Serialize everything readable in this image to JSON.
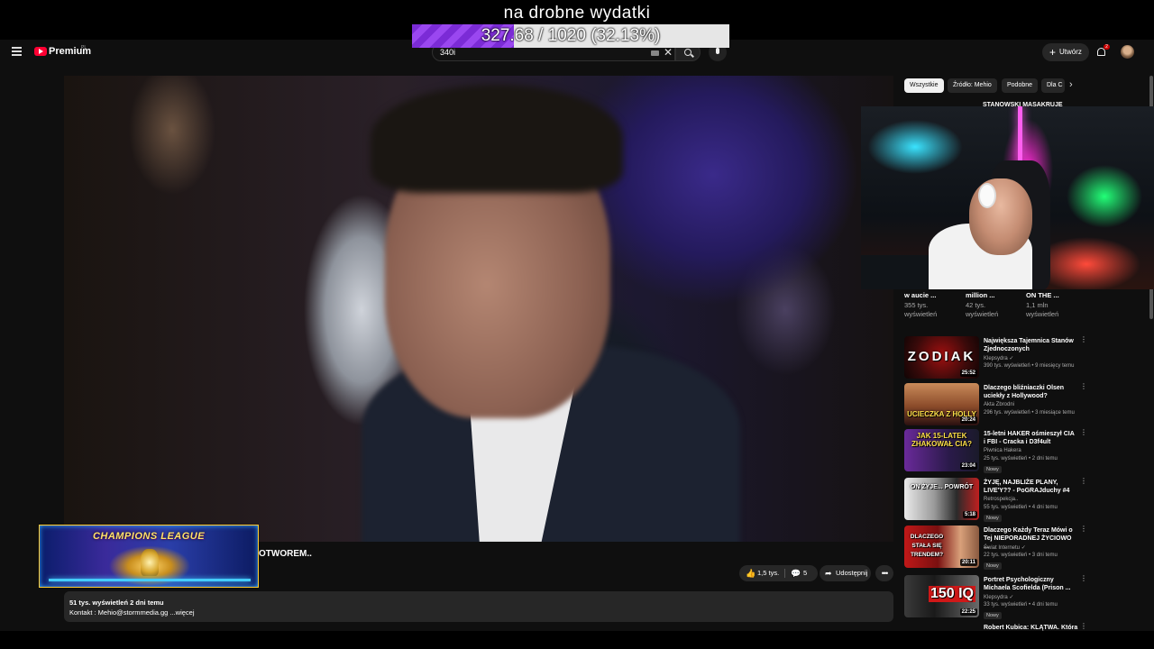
{
  "overlay": {
    "title": "na drobne wydatki",
    "donation_text": "327.68 / 1020 (32.13%)",
    "donation_fraction": 0.3213,
    "fill_color": "#8a3ae6"
  },
  "header": {
    "brand": "Premium",
    "brand_sup": "PL",
    "search_value": "340i",
    "create_label": "Utwórz",
    "notifications_count": "2"
  },
  "video": {
    "title_fragment": "OTWOREM..",
    "likes": "1,5 tys.",
    "comments": "5",
    "share_label": "Udostępnij",
    "more": "•••"
  },
  "description": {
    "line1": "51 tys. wyświetleń  2 dni temu",
    "line2": "Kontakt : Mehio@stormmedia.gg ...więcej"
  },
  "overlay_cl": {
    "title": "CHAMPIONS LEAGUE"
  },
  "chips": [
    {
      "label": "Wszystkie",
      "active": true
    },
    {
      "label": "Źródło: Mehio",
      "active": false
    },
    {
      "label": "Podobne",
      "active": false
    },
    {
      "label": "Dla C",
      "active": false
    }
  ],
  "shorts_peek": {
    "top_title": "STANOWSKI MASAKRUJE",
    "items": [
      {
        "title": "w aucie ...",
        "stat1": "355 tys.",
        "stat2": "wyświetleń"
      },
      {
        "title": "million ...",
        "stat1": "42 tys.",
        "stat2": "wyświetleń"
      },
      {
        "title": "ON THE ...",
        "stat1": "1,1 mln",
        "stat2": "wyświetleń"
      }
    ]
  },
  "recommendations": [
    {
      "title": "Największa Tajemnica Stanów Zjednoczonych",
      "channel": "Klepsydra ✓",
      "views": "390 tys. wyświetleń • 9 miesięcy temu",
      "duration": "25:52",
      "thumb_text": "ZODIAK",
      "new": ""
    },
    {
      "title": "Dlaczego bliźniaczki Olsen uciekły z Hollywood?",
      "channel": "Akta Zbrodni",
      "views": "296 tys. wyświetleń • 3 miesiące temu",
      "duration": "20:24",
      "thumb_text": "UCIECZKA Z HOLLY",
      "new": ""
    },
    {
      "title": "15-letni HAKER ośmieszył CIA i FBI - Cracka i D3f4ult",
      "channel": "Piwnica Hakera",
      "views": "25 tys. wyświetleń • 2 dni temu",
      "duration": "23:04",
      "thumb_text": "JAK 15-LATEK ZHAKOWAŁ CIA?",
      "new": "Nowy"
    },
    {
      "title": "ŻYJĘ, NAJBLIŻE PLANY, LIVE'Y?? - PoGRAJduchy #4",
      "channel": "Retrospekcja..",
      "views": "55 tys. wyświetleń • 4 dni temu",
      "duration": "5:18",
      "thumb_text": "ON ŻYJE... POWRÓT",
      "new": "Nowy"
    },
    {
      "title": "Dlaczego Każdy Teraz Mówi o Tej NIEPORADNEJ ŻYCIOWO ...",
      "channel": "Świat Internetu ✓",
      "views": "22 tys. wyświetleń • 3 dni temu",
      "duration": "20:11",
      "thumb_text": "DLACZEGO STAŁA SIĘ TRENDEM?",
      "new": "Nowy"
    },
    {
      "title": "Portret Psychologiczny Michaela Scofielda (Prison ...",
      "channel": "Klepsydra ✓",
      "views": "33 tys. wyświetleń • 4 dni temu",
      "duration": "22:25",
      "thumb_text": "150 IQ",
      "new": "Nowy"
    },
    {
      "title": "Robert Kubica: KLĄTWA. Która",
      "channel": "",
      "views": "",
      "duration": "",
      "thumb_text": "",
      "new": ""
    }
  ]
}
